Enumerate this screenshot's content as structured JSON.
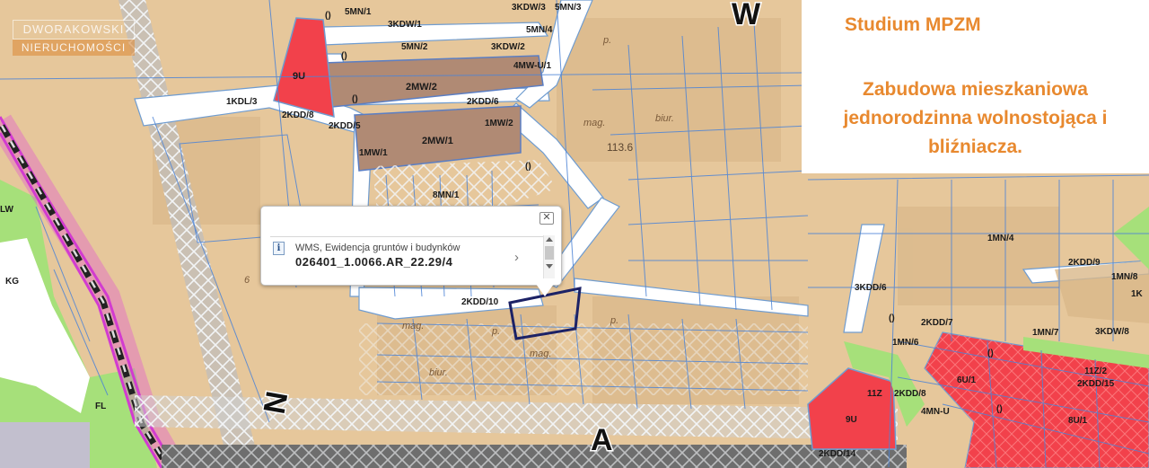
{
  "logo": {
    "line1": "DWORAKOWSKI",
    "line2": "NIERUCHOMOŚCI"
  },
  "legend": {
    "title": "Studium MPZM",
    "description": "Zabudowa mieszkaniowa jednorodzinna wolnostojąca i bliźniacza."
  },
  "popup": {
    "close_glyph": "✕",
    "info_glyph": "i",
    "layer_name": "WMS, Ewidencja gruntów i budynków",
    "parcel_id": "026401_1.0066.AR_22.29/4",
    "next_glyph": "›"
  },
  "map": {
    "big_letters": {
      "n": "N",
      "a": "A",
      "w": "W"
    },
    "elevation": "113.6",
    "zones": {
      "z9u_top": "9U",
      "z5mn1": "5MN/1",
      "z3kdw3": "3KDW/3",
      "z3kdw1": "3KDW/1",
      "z5mn3": "5MN/3",
      "z5mn4": "5MN/4",
      "z3kdw2": "3KDW/2",
      "z5mn2": "5MN/2",
      "z4mwu1": "4MW-U/1",
      "z2mw2": "2MW/2",
      "z1kdl3": "1KDL/3",
      "z2kdd8": "2KDD/8",
      "z2kdd5": "2KDD/5",
      "z2kdd6": "2KDD/6",
      "z1mw2": "1MW/2",
      "z2mw1": "2MW/1",
      "z1mw1": "1MW/1",
      "z8mn1": "8MN/1",
      "z2kdd10": "2KDD/10",
      "z1mn4": "1MN/4",
      "z2kdd9": "2KDD/9",
      "z1mn8": "1MN/8",
      "z3kdd6": "3KDD/6",
      "z2kdd7": "2KDD/7",
      "z1mn6": "1MN/6",
      "z1mn7": "1MN/7",
      "z3kdw8": "3KDW/8",
      "z11z2": "11Z/2",
      "z2kdd15": "2KDD/15",
      "z6u1": "6U/1",
      "z11z": "11Z",
      "z2kdd8b": "2KDD/8",
      "z4mnu": "4MN-U",
      "z9u_bot": "9U",
      "z8u1": "8U/1",
      "z2kdd14": "2KDD/14",
      "zlw": "LW",
      "zkg": "KG",
      "zfl": "FL",
      "z1k": "1K"
    },
    "zero_marker": "()",
    "ground_labels": {
      "mag1": "mag.",
      "mag2": "mag.",
      "mag3": "mag.",
      "biur1": "biur.",
      "biur2": "biur.",
      "p1": "p.",
      "p2": "p.",
      "p3": "p.",
      "num": "6"
    }
  }
}
